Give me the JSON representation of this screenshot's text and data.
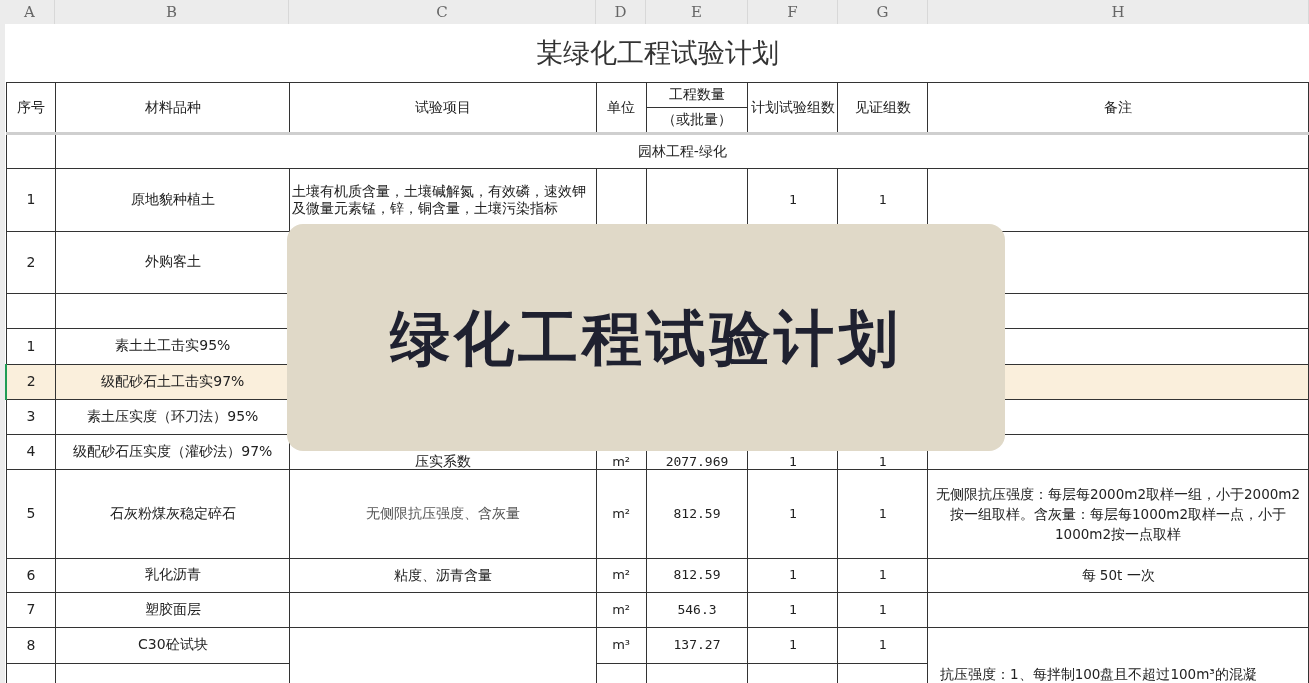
{
  "column_headers": [
    "A",
    "B",
    "C",
    "D",
    "E",
    "F",
    "G",
    "H"
  ],
  "title": "某绿化工程试验计划",
  "header": {
    "number": "序号",
    "material": "材料品种",
    "test_items": "试验项目",
    "unit": "单位",
    "quantity": [
      "工程数量",
      "（或批量）"
    ],
    "planned_groups": "计划试验组数",
    "witness_groups": "见证组数",
    "remarks": "备注"
  },
  "rows": [
    {
      "kind": "section",
      "label": "园林工程-绿化",
      "selected": false
    },
    {
      "kind": "data",
      "number": "1",
      "material": "原地貌种植土",
      "test_items": "土壤有机质含量，土壤碱解氮，有效磷，速效钾及微量元素锰，锌，铜含量，土壤污染指标",
      "planned_groups": "1",
      "witness_groups": "1",
      "selected": false
    },
    {
      "kind": "data",
      "number": "2",
      "material": "外购客土",
      "selected": false
    },
    {
      "kind": "section",
      "selected": false
    },
    {
      "kind": "data",
      "number": "1",
      "material": "素土土工击实95%",
      "selected": false
    },
    {
      "kind": "data",
      "number": "2",
      "material": "级配砂石土工击实97%",
      "selected": true
    },
    {
      "kind": "data",
      "number": "3",
      "material": "素土压实度（环刀法）95%",
      "selected": false
    },
    {
      "kind": "data",
      "number": "4",
      "material": "级配砂石压实度（灌砂法）97%",
      "test_items": "压实系数",
      "unit": "m²",
      "quantity": "2077.969",
      "planned_groups": "1",
      "witness_groups": "1",
      "selected": false
    },
    {
      "kind": "data",
      "number": "5",
      "material": "石灰粉煤灰稳定碎石",
      "test_items": "无侧限抗压强度、含灰量",
      "unit": "m²",
      "quantity": "812.59",
      "planned_groups": "1",
      "witness_groups": "1",
      "remarks": "无侧限抗压强度：每层每2000m2取样一组，小于2000m2按一组取样。含灰量：每层每1000m2取样一点，小于1000m2按一点取样",
      "selected": false
    },
    {
      "kind": "data",
      "number": "6",
      "material": "乳化沥青",
      "test_items": "粘度、沥青含量",
      "unit": "m²",
      "quantity": "812.59",
      "planned_groups": "1",
      "witness_groups": "1",
      "remarks": "每 50t 一次",
      "selected": false
    },
    {
      "kind": "data",
      "number": "7",
      "material": "塑胶面层",
      "unit": "m²",
      "quantity": "546.3",
      "planned_groups": "1",
      "witness_groups": "1",
      "selected": false
    },
    {
      "kind": "data",
      "number": "8",
      "material": "C30砼试块",
      "unit": "m³",
      "quantity": "137.27",
      "planned_groups": "1",
      "witness_groups": "1",
      "remarks": "抗压强度：1、每拌制100盘且不超过100m³的混凝",
      "span_next": true,
      "selected": false
    },
    {
      "kind": "partial",
      "selected": false
    }
  ],
  "banner": {
    "title": "绿化工程试验计划"
  }
}
